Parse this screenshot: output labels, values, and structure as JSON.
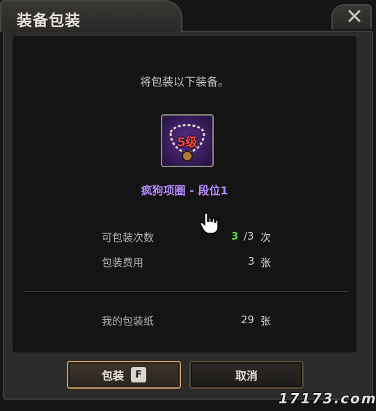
{
  "window": {
    "title": "装备包装"
  },
  "dialog": {
    "prompt": "将包装以下装备。",
    "item": {
      "level_label": "5级",
      "name": "疯狗项圈 - 段位1"
    },
    "rows": {
      "count_label": "可包装次数",
      "count_current": "3",
      "count_max": "/3",
      "count_unit": "次",
      "cost_label": "包装费用",
      "cost_value": "3",
      "cost_unit": "张",
      "owned_label": "我的包装纸",
      "owned_value": "29",
      "owned_unit": "张"
    }
  },
  "buttons": {
    "pack_label": "包装",
    "pack_hotkey": "F",
    "cancel_label": "取消"
  },
  "watermark": "17173.com",
  "colors": {
    "item_name": "#b48cff",
    "count_current": "#5ed23e",
    "pack_border": "#c39a62"
  }
}
